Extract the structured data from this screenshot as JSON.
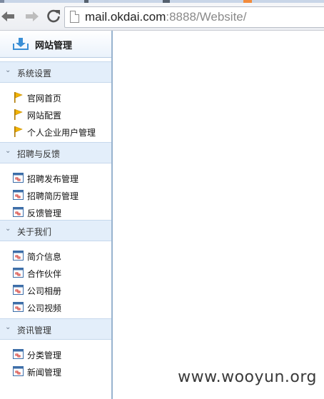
{
  "browser": {
    "url_main": "mail.okdai.com",
    "url_rest": ":8888/Website/"
  },
  "sidebar": {
    "title": "网站管理",
    "sections": [
      {
        "label": "系统设置",
        "items": [
          "官网首页",
          "网站配置",
          "个人企业用户管理"
        ]
      },
      {
        "label": "招聘与反馈",
        "items": [
          "招聘发布管理",
          "招聘简历管理",
          "反馈管理"
        ]
      },
      {
        "label": "关于我们",
        "items": [
          "简介信息",
          "合作伙伴",
          "公司相册",
          "公司视频"
        ]
      },
      {
        "label": "资讯管理",
        "items": [
          "分类管理",
          "新闻管理"
        ]
      }
    ]
  },
  "watermark": "www.wooyun.org",
  "colors": {
    "section_bg": "#e3eefa",
    "frame_border": "#98b3cf",
    "flag": "#f2b400"
  }
}
